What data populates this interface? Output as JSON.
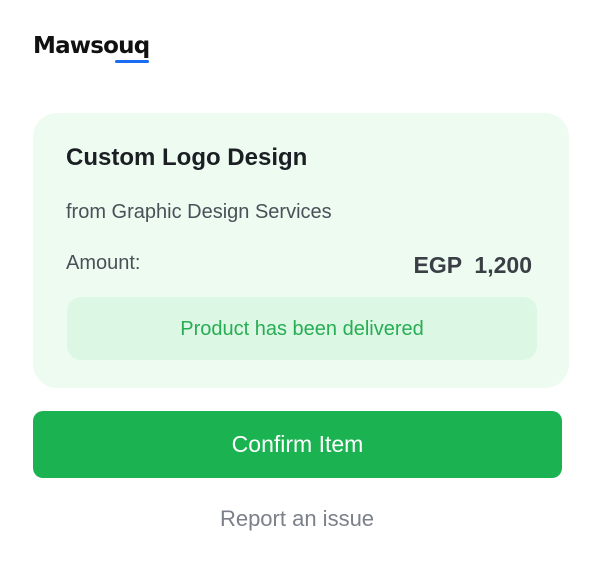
{
  "brand": {
    "name": "Mawsouq",
    "accent_color": "#1a6df0"
  },
  "order": {
    "product_title": "Custom Logo Design",
    "seller_line": "from Graphic Design Services",
    "amount_label": "Amount:",
    "amount_value": "EGP  1,200",
    "status_message": "Product has been delivered",
    "status_color": "#27ad53"
  },
  "actions": {
    "confirm_label": "Confirm Item",
    "confirm_color": "#1bb352",
    "report_label": "Report an issue"
  }
}
